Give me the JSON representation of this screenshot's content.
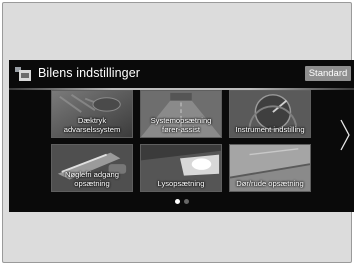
{
  "header": {
    "title": "Bilens indstillinger",
    "standard_label": "Standard"
  },
  "tiles": [
    {
      "line1": "Dæktryk",
      "line2": "advarselssystem",
      "icon": "tire-pressure-icon"
    },
    {
      "line1": "Systemopsætning",
      "line2": "fører-assist",
      "icon": "driver-assist-icon"
    },
    {
      "line1": "Instrument indstilling",
      "line2": "",
      "icon": "instrument-icon"
    },
    {
      "line1": "Nøglefri adgang",
      "line2": "opsætning",
      "icon": "keyless-entry-icon"
    },
    {
      "line1": "Lysopsætning",
      "line2": "",
      "icon": "headlight-icon"
    },
    {
      "line1": "Dør/rude opsætning",
      "line2": "",
      "icon": "door-window-icon"
    }
  ],
  "pagination": {
    "pages": 2,
    "current": 1
  },
  "colors": {
    "screen_bg": "#0a0a0a",
    "tile_bg": "#6b6b6b",
    "button_bg": "#8f8f8f",
    "dot_active": "#ffffff",
    "dot_inactive": "#666666"
  }
}
